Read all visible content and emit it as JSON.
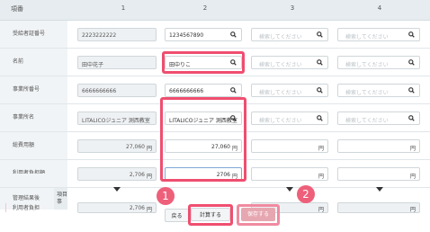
{
  "header": {
    "col0": "項番",
    "cols": [
      "1",
      "2",
      "3",
      "4"
    ]
  },
  "rows": {
    "recipient_no": "受給者証番号",
    "name": "名前",
    "office_no": "事業所番号",
    "office_name": "事業所名",
    "total_cost": "総費用額",
    "user_burden": "利用者負担額",
    "managed_burden_a": "管理結果後",
    "managed_burden_b": "利用者負担",
    "managed_burden_c": "額",
    "item_label": "項目",
    "item_label2": "事"
  },
  "col1": {
    "recipient_no": "2223222222",
    "name": "田中花子",
    "office_no": "6666666666",
    "office_name": "LITALICOジュニア 測西教室",
    "total_cost": "27,060",
    "user_burden": "2,706",
    "managed_burden": "2,706"
  },
  "col2": {
    "recipient_no": "1234567890",
    "name": "田中りこ",
    "office_no": "6666666666",
    "office_name": "LITALICOジュニア 測西教室",
    "total_cost": "27,060",
    "user_burden": "2706"
  },
  "placeholder": "検索してください",
  "yen": "円",
  "buttons": {
    "back": "戻る",
    "calc": "計算する",
    "save": "保存する"
  },
  "markers": {
    "one": "1",
    "two": "2"
  },
  "colors": {
    "highlight": "#ef4e6f",
    "marker": "#ee5f7a",
    "save_button": "#e6a7b1"
  }
}
